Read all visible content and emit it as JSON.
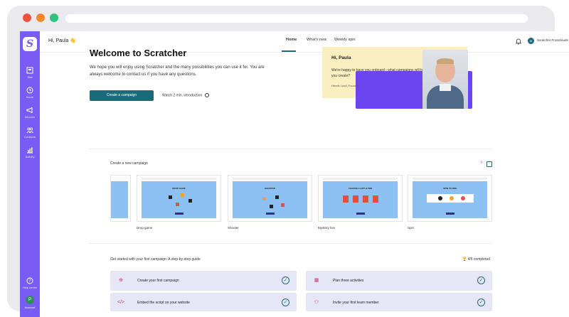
{
  "sidebar": {
    "logo": "S",
    "items": [
      {
        "label": "Stat",
        "icon": "dashboard-icon"
      },
      {
        "label": "Score",
        "icon": "clock-icon"
      },
      {
        "label": "Inboxes",
        "icon": "megaphone-icon"
      },
      {
        "label": "Contacts",
        "icon": "people-icon"
      },
      {
        "label": "Activity",
        "icon": "chart-icon"
      }
    ],
    "help_label": "Help center",
    "account_initial": "P",
    "account_label": "Account"
  },
  "header": {
    "greeting": "Hi, Paula 👋",
    "tabs": [
      {
        "label": "Home",
        "active": true
      },
      {
        "label": "What's new",
        "active": false
      },
      {
        "label": "Weekly spin",
        "active": false
      }
    ],
    "user_initial": "M",
    "user_name": "Scratcher Frostclouds"
  },
  "hero": {
    "title": "Welcome to Scratcher",
    "text": "We hope you will enjoy using Scratcher and the many possibilities you can use it for. You are always welcome to contact us if you have any questions.",
    "create_button": "Create a campaign",
    "watch_link": "Watch 2 min. introduction"
  },
  "welcome_card": {
    "hi": "Hi, Paula",
    "message": "We're happy to have you onboard - what campaigns will be the ones you create?",
    "signature": "Henrik Lund, Founder"
  },
  "campaigns": {
    "title": "Create a new campaign",
    "prev_arrow": "‹",
    "items": [
      {
        "label": "Drop game",
        "game_title": "DROP GAME"
      },
      {
        "label": "Shooter",
        "game_title": "SHOOTER"
      },
      {
        "label": "Mystery box",
        "game_title": "CHOOSE A GIFT & WIN"
      },
      {
        "label": "Spin",
        "game_title": "SPIN TO WIN"
      }
    ]
  },
  "guide": {
    "title": "Get started with your first campaign: A step-by-step guide",
    "completed": "4/6 completed",
    "steps": [
      {
        "label": "Create your first campaign",
        "icon": "plus-circle-icon"
      },
      {
        "label": "Plan three activities",
        "icon": "calendar-icon"
      },
      {
        "label": "Embed the script on your website",
        "icon": "code-icon"
      },
      {
        "label": "Invite your first team member",
        "icon": "team-icon"
      }
    ]
  },
  "colors": {
    "sidebar": "#7a5cf5",
    "accent": "#1d6a7a",
    "card_yellow": "#fbeec0",
    "card_purple": "#6a45f0",
    "step_bg": "#e6e7f6"
  }
}
